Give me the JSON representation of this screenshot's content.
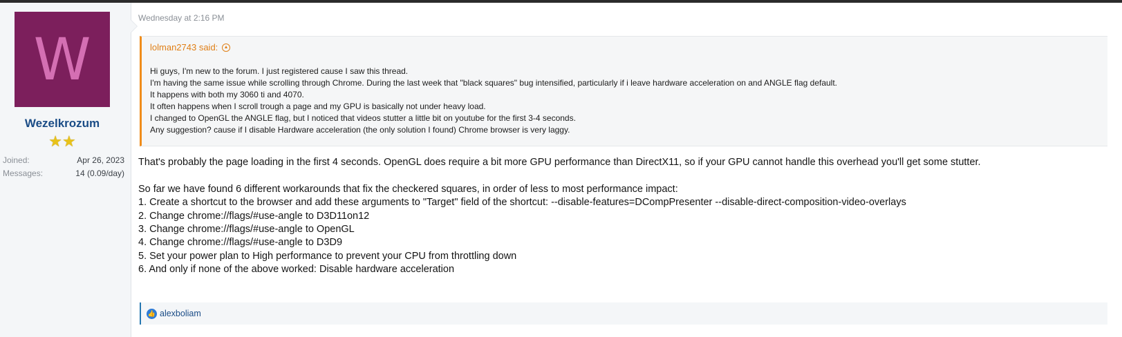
{
  "post": {
    "date": "Wednesday at 2:16 PM",
    "user": {
      "avatar_letter": "W",
      "avatar_color": "#7c1f5c",
      "username": "Wezelkrozum",
      "stars": "★★",
      "joined_label": "Joined:",
      "joined_value": "Apr 26, 2023",
      "messages_label": "Messages:",
      "messages_value": "14 (0.09/day)"
    },
    "quote": {
      "author": "lolman2743 said:",
      "icon": "arrow-up-circle-icon",
      "lines": [
        "Hi guys, I'm new to the forum. I just registered cause I saw this thread.",
        "I'm having the same issue while scrolling through Chrome. During the last week that \"black squares\" bug intensified, particularly if i leave hardware acceleration on and ANGLE flag default.",
        "It happens with both my 3060 ti and 4070.",
        "It often happens when I scroll trough a page and my GPU is basically not under heavy load.",
        "I changed to OpenGL the ANGLE flag, but I noticed that videos stutter a little bit on youtube for the first 3-4 seconds.",
        "Any suggestion? cause if I disable Hardware acceleration (the only solution I found) Chrome browser is very laggy."
      ]
    },
    "body": {
      "paragraph1": "That's probably the page loading in the first 4 seconds. OpenGL does require a bit more GPU performance than DirectX11, so if your GPU cannot handle this overhead you'll get some stutter.",
      "intro": "So far we have found 6 different workarounds that fix the checkered squares, in order of less to most performance impact:",
      "steps": [
        "1. Create a shortcut to the browser and add these arguments to \"Target\" field of the shortcut: --disable-features=DCompPresenter --disable-direct-composition-video-overlays",
        "2. Change chrome://flags/#use-angle to D3D11on12",
        "3. Change chrome://flags/#use-angle to OpenGL",
        "4. Change chrome://flags/#use-angle to D3D9",
        "5. Set your power plan to High performance to prevent your CPU from throttling down",
        "6. And only if none of the above worked: Disable hardware acceleration"
      ]
    },
    "reactions": {
      "icon": "like-icon",
      "users": "alexboliam"
    }
  }
}
